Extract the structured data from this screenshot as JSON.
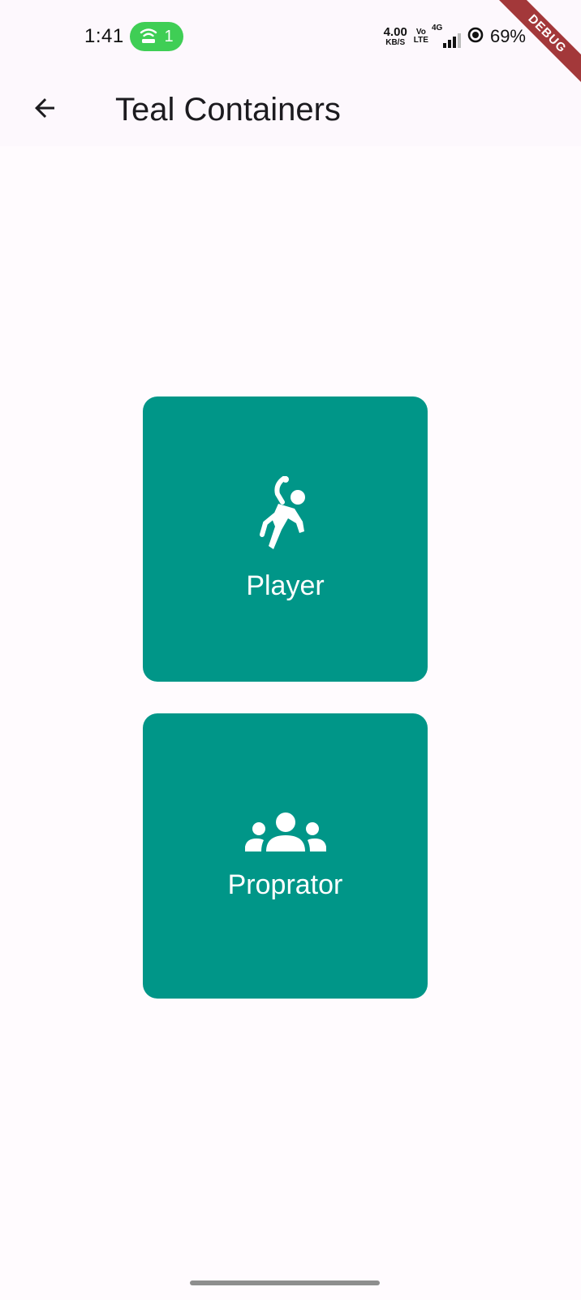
{
  "status_bar": {
    "time": "1:41",
    "hotspot_count": "1",
    "net_speed_value": "4.00",
    "net_speed_unit": "KB/S",
    "volte_top": "Vo",
    "volte_bottom": "LTE",
    "network_type": "4G",
    "battery_percent": "69%",
    "hotspot_color": "#3fce55"
  },
  "debug_banner": "DEBUG",
  "app_bar": {
    "title": "Teal Containers",
    "back_icon": "arrow-back-icon"
  },
  "cards": [
    {
      "label": "Player",
      "icon": "sports-handball-icon"
    },
    {
      "label": "Proprator",
      "icon": "groups-icon"
    }
  ],
  "colors": {
    "card_background": "#009688",
    "app_bar_background": "#fdf8fd",
    "page_background": "#fffbfe",
    "debug_banner": "#a3383a"
  }
}
